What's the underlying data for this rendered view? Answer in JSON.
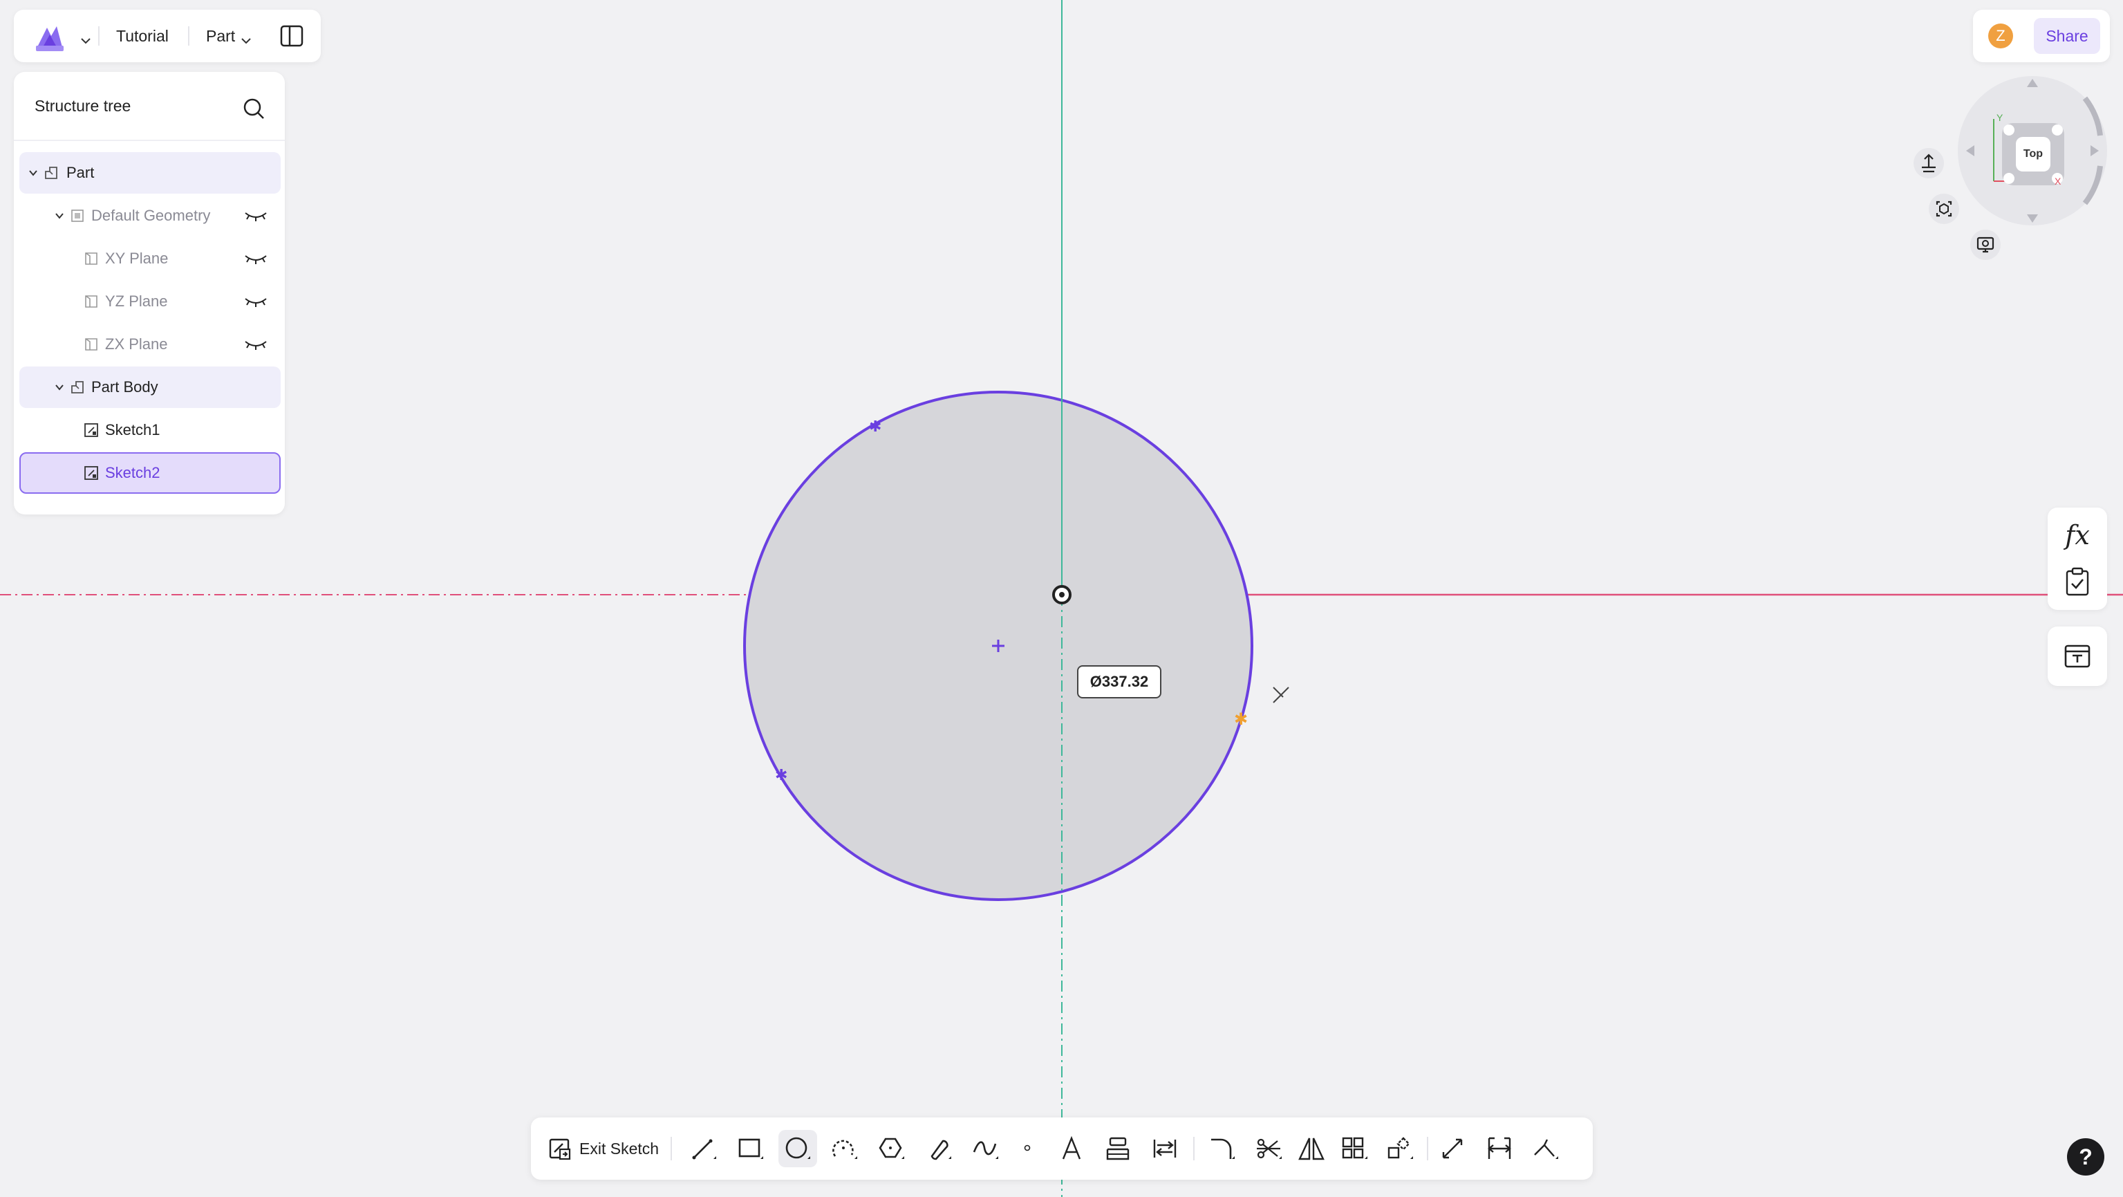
{
  "topbar": {
    "workspace": "Tutorial",
    "document": "Part"
  },
  "tree": {
    "title": "Structure tree",
    "items": [
      {
        "label": "Part"
      },
      {
        "label": "Default Geometry"
      },
      {
        "label": "XY Plane"
      },
      {
        "label": "YZ Plane"
      },
      {
        "label": "ZX Plane"
      },
      {
        "label": "Part Body"
      },
      {
        "label": "Sketch1"
      },
      {
        "label": "Sketch2"
      }
    ]
  },
  "header_right": {
    "avatar_initial": "Z",
    "share_label": "Share"
  },
  "viewcube": {
    "face": "Top",
    "axis_x": "X",
    "axis_y": "Y"
  },
  "sketch": {
    "diameter_label": "Ø337.32",
    "circle_fill": "#d6d6da",
    "circle_stroke": "#6a3fe0",
    "horizontal_axis_color": "#e0507a",
    "vertical_axis_color": "#3fb89a"
  },
  "side": {
    "formula_label": "fx"
  },
  "toolbar": {
    "exit_label": "Exit Sketch",
    "tools": [
      "line-icon",
      "rectangle-icon",
      "circle-icon",
      "arc-icon",
      "polygon-icon",
      "slot-icon",
      "spline-icon",
      "point-icon",
      "text-icon",
      "project-icon",
      "offset-icon",
      "fillet-icon",
      "trim-icon",
      "mirror-icon",
      "pattern-icon",
      "transform-icon",
      "construction-icon",
      "dimension-icon",
      "constraint-icon"
    ]
  },
  "help_label": "?"
}
